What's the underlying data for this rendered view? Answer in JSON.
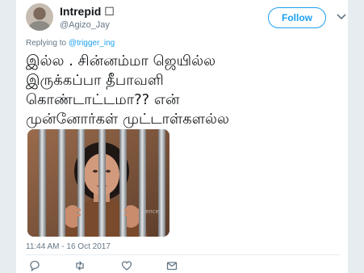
{
  "user": {
    "display_name": "Intrepid ☐",
    "handle": "@Agizo_Jay"
  },
  "follow_label": "Follow",
  "reply": {
    "prefix": "Replying to ",
    "mention": "@trigger_ing"
  },
  "tweet_lines": [
    "இல்ல . சின்னம்மா ஜெயில்ல",
    "இருக்கப்பா தீபாவளி",
    "கொண்டாட்டமா?? என்",
    "முன்னோர்கள் முட்டாள்களல்ல"
  ],
  "media": {
    "icon": "person-behind-bars-photo",
    "watermark": "ence"
  },
  "timestamp": "11:44 AM - 16 Oct 2017",
  "colors": {
    "accent": "#1da1f2",
    "text": "#14171a",
    "muted": "#657786"
  }
}
